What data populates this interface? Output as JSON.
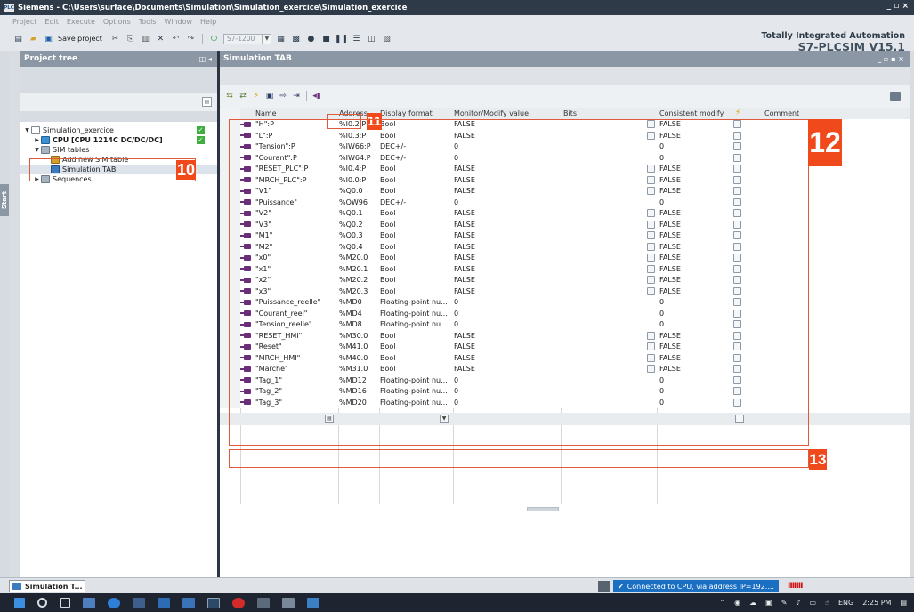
{
  "window": {
    "title": "Siemens  -  C:\\Users\\surface\\Documents\\Simulation\\Simulation_exercice\\Simulation_exercice",
    "logo_text": "PLC SIM",
    "controls": "_ ▫ ×"
  },
  "menu": [
    "Project",
    "Edit",
    "Execute",
    "Options",
    "Tools",
    "Window",
    "Help"
  ],
  "toolbar": {
    "save_label": "Save project",
    "cpu_combo": "S7-1200"
  },
  "brand": {
    "line1": "Totally Integrated Automation",
    "line2": "S7-PLCSIM V15.1"
  },
  "start_tab": "Start",
  "project_tree": {
    "title": "Project tree",
    "controls": "◫ ◂",
    "items": [
      {
        "label": "Simulation_exercice",
        "level": 0,
        "arrow": "▼",
        "icon": "doc",
        "check": true
      },
      {
        "label": "CPU [CPU 1214C DC/DC/DC]",
        "level": 1,
        "arrow": "▶",
        "icon": "cpu",
        "check": true
      },
      {
        "label": "SIM tables",
        "level": 1,
        "arrow": "▼",
        "icon": "folder",
        "check": false
      },
      {
        "label": "Add new SIM table",
        "level": 2,
        "arrow": "",
        "icon": "add",
        "check": false
      },
      {
        "label": "Simulation TAB",
        "level": 2,
        "arrow": "",
        "icon": "sim",
        "check": false,
        "selected": true
      },
      {
        "label": "Sequences",
        "level": 1,
        "arrow": "▶",
        "icon": "folder",
        "check": false
      }
    ]
  },
  "sim_panel": {
    "title": "Simulation TAB",
    "controls": "_ ▫ ▪ ×",
    "columns": {
      "name": "Name",
      "address": "Address",
      "format": "Display format",
      "monitor": "Monitor/Modify value",
      "bits": "Bits",
      "consistent": "Consistent modify",
      "comment": "Comment"
    },
    "rows": [
      {
        "name": "\"H\":P",
        "address": "%I0.2:P",
        "format": "Bool",
        "monitor": "FALSE",
        "has_bits": true,
        "consistent": "FALSE"
      },
      {
        "name": "\"L\":P",
        "address": "%I0.3:P",
        "format": "Bool",
        "monitor": "FALSE",
        "has_bits": true,
        "consistent": "FALSE"
      },
      {
        "name": "\"Tension\":P",
        "address": "%IW66:P",
        "format": "DEC+/-",
        "monitor": "0",
        "has_bits": false,
        "consistent": "0"
      },
      {
        "name": "\"Courant\":P",
        "address": "%IW64:P",
        "format": "DEC+/-",
        "monitor": "0",
        "has_bits": false,
        "consistent": "0"
      },
      {
        "name": "\"RESET_PLC\":P",
        "address": "%I0.4:P",
        "format": "Bool",
        "monitor": "FALSE",
        "has_bits": true,
        "consistent": "FALSE"
      },
      {
        "name": "\"MRCH_PLC\":P",
        "address": "%I0.0:P",
        "format": "Bool",
        "monitor": "FALSE",
        "has_bits": true,
        "consistent": "FALSE"
      },
      {
        "name": "\"V1\"",
        "address": "%Q0.0",
        "format": "Bool",
        "monitor": "FALSE",
        "has_bits": true,
        "consistent": "FALSE"
      },
      {
        "name": "\"Puissance\"",
        "address": "%QW96",
        "format": "DEC+/-",
        "monitor": "0",
        "has_bits": false,
        "consistent": "0"
      },
      {
        "name": "\"V2\"",
        "address": "%Q0.1",
        "format": "Bool",
        "monitor": "FALSE",
        "has_bits": true,
        "consistent": "FALSE"
      },
      {
        "name": "\"V3\"",
        "address": "%Q0.2",
        "format": "Bool",
        "monitor": "FALSE",
        "has_bits": true,
        "consistent": "FALSE"
      },
      {
        "name": "\"M1\"",
        "address": "%Q0.3",
        "format": "Bool",
        "monitor": "FALSE",
        "has_bits": true,
        "consistent": "FALSE"
      },
      {
        "name": "\"M2\"",
        "address": "%Q0.4",
        "format": "Bool",
        "monitor": "FALSE",
        "has_bits": true,
        "consistent": "FALSE"
      },
      {
        "name": "\"x0\"",
        "address": "%M20.0",
        "format": "Bool",
        "monitor": "FALSE",
        "has_bits": true,
        "consistent": "FALSE"
      },
      {
        "name": "\"x1\"",
        "address": "%M20.1",
        "format": "Bool",
        "monitor": "FALSE",
        "has_bits": true,
        "consistent": "FALSE"
      },
      {
        "name": "\"x2\"",
        "address": "%M20.2",
        "format": "Bool",
        "monitor": "FALSE",
        "has_bits": true,
        "consistent": "FALSE"
      },
      {
        "name": "\"x3\"",
        "address": "%M20.3",
        "format": "Bool",
        "monitor": "FALSE",
        "has_bits": true,
        "consistent": "FALSE"
      },
      {
        "name": "\"Puissance_reelle\"",
        "address": "%MD0",
        "format": "Floating-point nu...",
        "monitor": "0",
        "has_bits": false,
        "consistent": "0"
      },
      {
        "name": "\"Courant_reel\"",
        "address": "%MD4",
        "format": "Floating-point nu...",
        "monitor": "0",
        "has_bits": false,
        "consistent": "0"
      },
      {
        "name": "\"Tension_reelle\"",
        "address": "%MD8",
        "format": "Floating-point nu...",
        "monitor": "0",
        "has_bits": false,
        "consistent": "0"
      },
      {
        "name": "\"RESET_HMI\"",
        "address": "%M30.0",
        "format": "Bool",
        "monitor": "FALSE",
        "has_bits": true,
        "consistent": "FALSE"
      },
      {
        "name": "\"Reset\"",
        "address": "%M41.0",
        "format": "Bool",
        "monitor": "FALSE",
        "has_bits": true,
        "consistent": "FALSE"
      },
      {
        "name": "\"MRCH_HMI\"",
        "address": "%M40.0",
        "format": "Bool",
        "monitor": "FALSE",
        "has_bits": true,
        "consistent": "FALSE"
      },
      {
        "name": "\"Marche\"",
        "address": "%M31.0",
        "format": "Bool",
        "monitor": "FALSE",
        "has_bits": true,
        "consistent": "FALSE"
      },
      {
        "name": "\"Tag_1\"",
        "address": "%MD12",
        "format": "Floating-point nu...",
        "monitor": "0",
        "has_bits": false,
        "consistent": "0"
      },
      {
        "name": "\"Tag_2\"",
        "address": "%MD16",
        "format": "Floating-point nu...",
        "monitor": "0",
        "has_bits": false,
        "consistent": "0"
      },
      {
        "name": "\"Tag_3\"",
        "address": "%MD20",
        "format": "Floating-point nu...",
        "monitor": "0",
        "has_bits": false,
        "consistent": "0"
      }
    ]
  },
  "annotations": {
    "a10": "10",
    "a11": "11",
    "a12": "12",
    "a13": "13"
  },
  "status": {
    "task_label": "Simulation T...",
    "connection": "Connected to CPU, via address IP=192....",
    "bars": "IIIIIII"
  },
  "tray": {
    "lang": "ENG",
    "time": "2:25 PM"
  },
  "colors": {
    "accent": "#f04a1c",
    "header": "#8b97a4",
    "status_blue": "#1b6fc2"
  }
}
